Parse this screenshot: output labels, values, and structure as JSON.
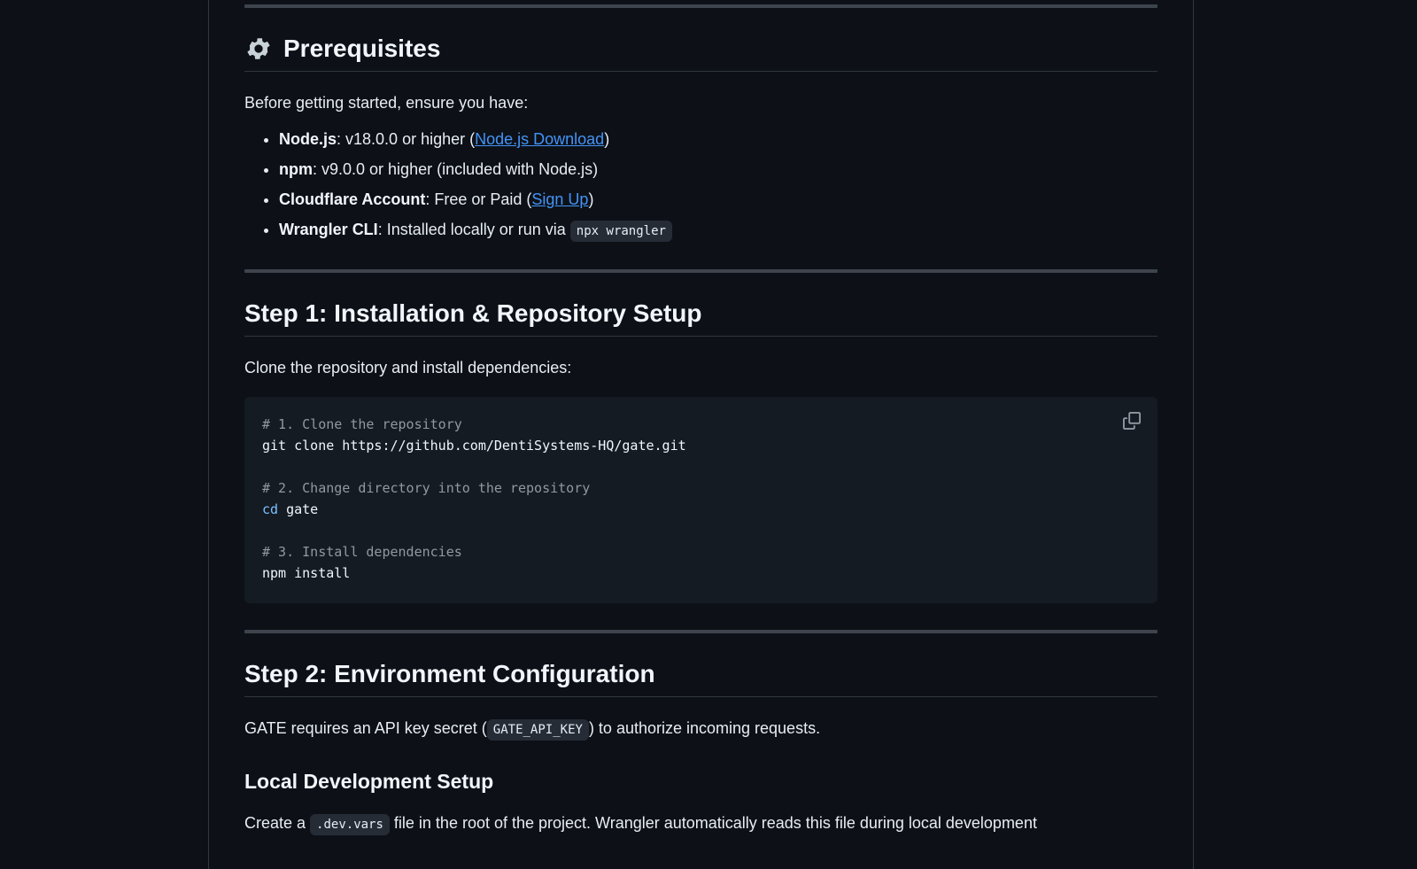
{
  "prereq": {
    "title": "Prerequisites",
    "intro": "Before getting started, ensure you have:",
    "items": [
      {
        "label": "Node.js",
        "text_before": ": v18.0.0 or higher (",
        "link": "Node.js Download",
        "text_after": ")"
      },
      {
        "label": "npm",
        "text_before": ": v9.0.0 or higher (included with Node.js)"
      },
      {
        "label": "Cloudflare Account",
        "text_before": ": Free or Paid (",
        "link": "Sign Up",
        "text_after": ")"
      },
      {
        "label": "Wrangler CLI",
        "text_before": ": Installed locally or run via ",
        "code": "npx wrangler"
      }
    ]
  },
  "step1": {
    "title": "Step 1: Installation & Repository Setup",
    "intro": "Clone the repository and install dependencies:",
    "code": {
      "c1": "# 1. Clone the repository",
      "l1": "git clone https://github.com/DentiSystems-HQ/gate.git",
      "c2": "# 2. Change directory into the repository",
      "l2_kw": "cd",
      "l2_rest": " gate",
      "c3": "# 3. Install dependencies",
      "l3": "npm install"
    },
    "copy_icon": "copy-icon"
  },
  "step2": {
    "title": "Step 2: Environment Configuration",
    "text_before": "GATE requires an API key secret (",
    "code": "GATE_API_KEY",
    "text_after": ") to authorize incoming requests.",
    "sub_title": "Local Development Setup",
    "create_before": "Create a ",
    "create_code": ".dev.vars",
    "create_after": " file in the root of the project. Wrangler automatically reads this file during local development"
  },
  "icons": {
    "prereq": "gear-icon"
  }
}
